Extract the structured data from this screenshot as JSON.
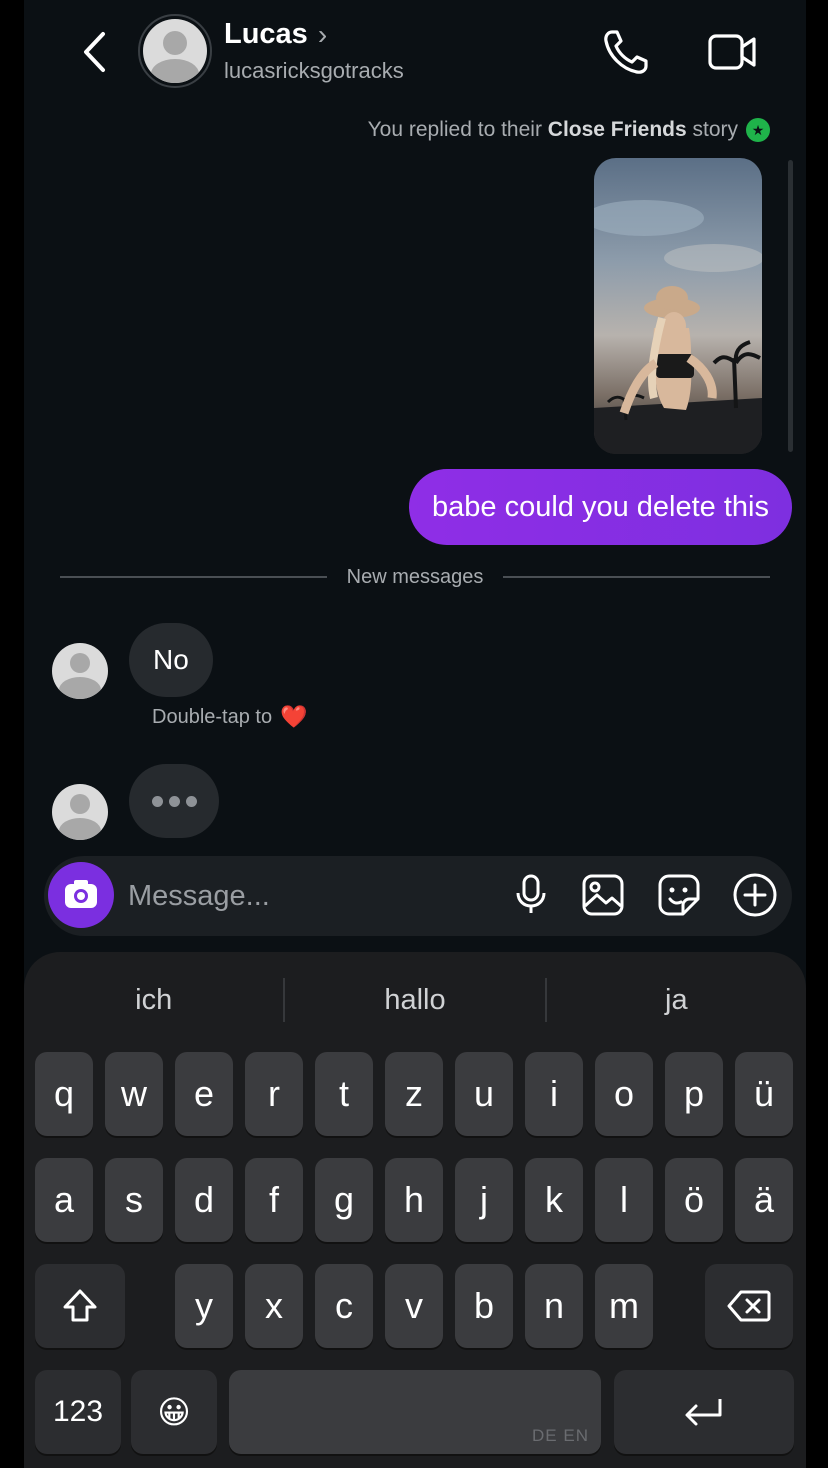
{
  "header": {
    "name": "Lucas",
    "chevron": "›",
    "username": "lucasricksgotracks",
    "icons": [
      "back-chevron-icon",
      "phone-icon",
      "video-camera-icon"
    ]
  },
  "story_reply": {
    "prefix": "You replied to their ",
    "emphasis": "Close Friends",
    "suffix": " story",
    "badge_icon": "star-icon",
    "badge_color": "#1fb34a"
  },
  "messages": {
    "outgoing": "babe could you delete this",
    "divider": "New messages",
    "incoming": "No",
    "double_tap": "Double-tap to",
    "heart": "❤️"
  },
  "composer": {
    "placeholder": "Message...",
    "icons": [
      "camera-icon",
      "microphone-icon",
      "gallery-icon",
      "sticker-icon",
      "plus-icon"
    ],
    "accent": "#7b2fe0"
  },
  "keyboard": {
    "suggestions": [
      "ich",
      "hallo",
      "ja"
    ],
    "row1": [
      "q",
      "w",
      "e",
      "r",
      "t",
      "z",
      "u",
      "i",
      "o",
      "p",
      "ü"
    ],
    "row2": [
      "a",
      "s",
      "d",
      "f",
      "g",
      "h",
      "j",
      "k",
      "l",
      "ö",
      "ä"
    ],
    "row3": [
      "y",
      "x",
      "c",
      "v",
      "b",
      "n",
      "m"
    ],
    "numbers_label": "123",
    "emoji": "😀",
    "space_lang": "DE EN",
    "icons": [
      "shift-icon",
      "backspace-icon",
      "return-icon"
    ]
  }
}
